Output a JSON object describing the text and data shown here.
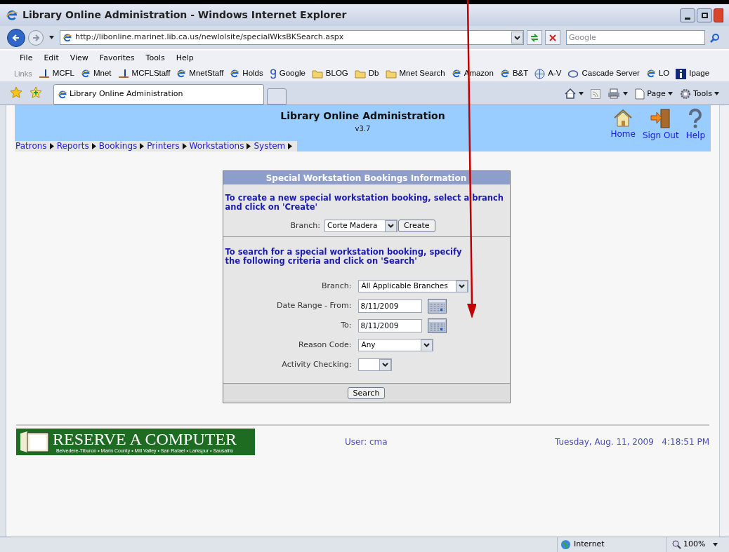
{
  "window": {
    "title": "Library Online Administration - Windows Internet Explorer"
  },
  "address_bar": {
    "url": "http://libonline.marinet.lib.ca.us/newlolsite/specialWksBKSearch.aspx",
    "search_placeholder": "Google"
  },
  "menu": [
    "File",
    "Edit",
    "View",
    "Favorites",
    "Tools",
    "Help"
  ],
  "links_bar": {
    "label": "Links",
    "items": [
      {
        "label": "MCFL",
        "kind": "page"
      },
      {
        "label": "Mnet",
        "kind": "ie"
      },
      {
        "label": "MCFLStaff",
        "kind": "page"
      },
      {
        "label": "MnetStaff",
        "kind": "ie"
      },
      {
        "label": "Holds",
        "kind": "ie"
      },
      {
        "label": "Google",
        "kind": "google"
      },
      {
        "label": "BLOG",
        "kind": "folder"
      },
      {
        "label": "Db",
        "kind": "folder"
      },
      {
        "label": "Mnet Search",
        "kind": "folder"
      },
      {
        "label": "Amazon",
        "kind": "ie"
      },
      {
        "label": "B&T",
        "kind": "ie"
      },
      {
        "label": "A-V",
        "kind": "globe"
      },
      {
        "label": "Cascade Server",
        "kind": "ring"
      },
      {
        "label": "LO",
        "kind": "ie"
      },
      {
        "label": "Ipage",
        "kind": "info"
      }
    ]
  },
  "tabs": [
    {
      "label": "Library Online Administration",
      "selected": true
    }
  ],
  "command_bar": [
    {
      "label": "Page"
    },
    {
      "label": "Tools"
    }
  ],
  "header": {
    "title": "Library Online Administration",
    "version": "v3.7",
    "actions": [
      {
        "label": "Home",
        "kind": "home"
      },
      {
        "label": "Sign Out",
        "kind": "signout"
      },
      {
        "label": "Help",
        "kind": "help"
      }
    ],
    "nav": [
      "Patrons",
      "Reports",
      "Bookings",
      "Printers",
      "Workstations",
      "System"
    ]
  },
  "panel": {
    "title": "Special Workstation Bookings Information",
    "create_text": "To create a new special workstation booking, select a branch and click on 'Create'",
    "create_branch": {
      "label": "Branch:",
      "value": "Corte Madera"
    },
    "create_button": "Create",
    "search_text": "To search for a special workstation booking, specify the following criteria and click on 'Search'",
    "fields": [
      {
        "label": "Branch:",
        "value": "All Applicable Branches",
        "kind": "select"
      },
      {
        "label": "Date Range - From:",
        "value": "8/11/2009",
        "kind": "date"
      },
      {
        "label": "To:",
        "value": "8/11/2009",
        "kind": "date"
      },
      {
        "label": "Reason Code:",
        "value": "Any",
        "kind": "select"
      },
      {
        "label": "Activity Checking:",
        "kind": "select"
      }
    ],
    "search_button": "Search"
  },
  "footer": {
    "logo_title": "RESERVE A COMPUTER",
    "logo_subtitle": "Belvedere-Tiburon • Marin County • Mill Valley • San Rafael • Larkspur • Sausalito",
    "user": "User: cma",
    "datetime": "Tuesday, Aug. 11, 2009   4:18:51 PM"
  },
  "status_bar": {
    "zone": "Internet",
    "zoom": "100%"
  }
}
